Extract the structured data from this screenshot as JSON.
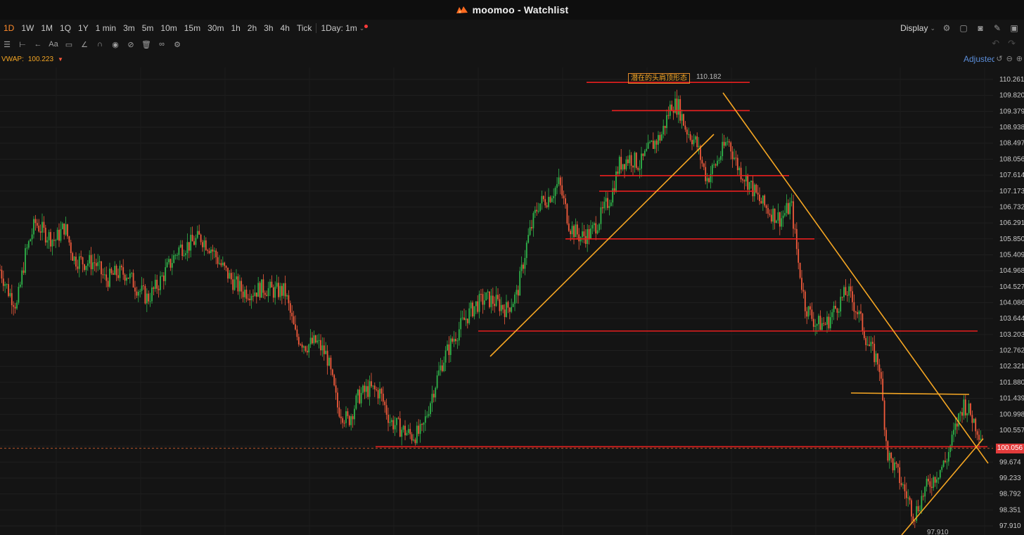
{
  "window": {
    "app_name": "moomoo",
    "title": "moomoo - Watchlist"
  },
  "toolbar": {
    "intervals": [
      {
        "label": "1D",
        "active": true
      },
      {
        "label": "1W"
      },
      {
        "label": "1M"
      },
      {
        "label": "1Q"
      },
      {
        "label": "1Y"
      },
      {
        "label": "1 min"
      },
      {
        "label": "3m"
      },
      {
        "label": "5m"
      },
      {
        "label": "10m"
      },
      {
        "label": "15m"
      },
      {
        "label": "30m"
      },
      {
        "label": "1h"
      },
      {
        "label": "2h"
      },
      {
        "label": "3h"
      },
      {
        "label": "4h"
      },
      {
        "label": "Tick"
      }
    ],
    "day_selector": "1Day: 1m",
    "display_label": "Display"
  },
  "indicators": {
    "vwap_label": "VWAP:",
    "vwap_value": "100.223"
  },
  "adjust_label": "Adjusted",
  "chart": {
    "price_axis": [
      "110.261",
      "109.820",
      "109.379",
      "108.938",
      "108.497",
      "108.056",
      "107.614",
      "107.173",
      "106.732",
      "106.291",
      "105.850",
      "105.409",
      "104.968",
      "104.527",
      "104.086",
      "103.644",
      "103.203",
      "102.762",
      "102.321",
      "101.880",
      "101.439",
      "100.998",
      "100.557",
      "100.056",
      "99.674",
      "99.233",
      "98.792",
      "98.351",
      "97.910"
    ],
    "current_price": "100.056",
    "high_label": "110.182",
    "low_label": "97.910",
    "annotation_text": "潜在的头肩顶形态",
    "colors": {
      "up": "#2fb34a",
      "down": "#f05a3b",
      "support": "#e81e1e",
      "trend": "#f5a623",
      "background": "#141414"
    }
  },
  "chart_data": {
    "type": "candlestick",
    "title": "",
    "ylim": [
      97.91,
      110.261
    ],
    "price_path": [
      [
        0,
        105.0
      ],
      [
        12,
        104.4
      ],
      [
        24,
        104.0
      ],
      [
        36,
        105.4
      ],
      [
        50,
        106.3
      ],
      [
        64,
        106.0
      ],
      [
        78,
        105.8
      ],
      [
        92,
        106.2
      ],
      [
        105,
        105.3
      ],
      [
        120,
        105.2
      ],
      [
        135,
        105.2
      ],
      [
        150,
        104.7
      ],
      [
        165,
        104.9
      ],
      [
        180,
        104.9
      ],
      [
        195,
        104.5
      ],
      [
        210,
        104.2
      ],
      [
        225,
        104.6
      ],
      [
        240,
        105.1
      ],
      [
        255,
        105.6
      ],
      [
        270,
        105.7
      ],
      [
        285,
        105.9
      ],
      [
        300,
        105.6
      ],
      [
        315,
        105.1
      ],
      [
        330,
        104.7
      ],
      [
        345,
        104.4
      ],
      [
        360,
        104.4
      ],
      [
        375,
        104.5
      ],
      [
        390,
        104.4
      ],
      [
        405,
        104.4
      ],
      [
        420,
        103.2
      ],
      [
        435,
        102.9
      ],
      [
        450,
        103.0
      ],
      [
        465,
        102.6
      ],
      [
        480,
        101.2
      ],
      [
        495,
        100.8
      ],
      [
        510,
        101.5
      ],
      [
        525,
        101.7
      ],
      [
        540,
        101.6
      ],
      [
        555,
        100.8
      ],
      [
        570,
        100.6
      ],
      [
        585,
        100.4
      ],
      [
        600,
        100.5
      ],
      [
        615,
        101.6
      ],
      [
        630,
        102.5
      ],
      [
        645,
        103.1
      ],
      [
        660,
        103.6
      ],
      [
        675,
        104.0
      ],
      [
        690,
        104.2
      ],
      [
        705,
        104.1
      ],
      [
        720,
        103.9
      ],
      [
        735,
        104.3
      ],
      [
        750,
        105.8
      ],
      [
        765,
        106.8
      ],
      [
        780,
        107.0
      ],
      [
        795,
        107.4
      ],
      [
        810,
        106.2
      ],
      [
        825,
        105.9
      ],
      [
        840,
        106.0
      ],
      [
        855,
        106.5
      ],
      [
        870,
        107.1
      ],
      [
        880,
        107.9
      ],
      [
        895,
        108.1
      ],
      [
        910,
        107.9
      ],
      [
        925,
        108.4
      ],
      [
        940,
        108.7
      ],
      [
        955,
        109.6
      ],
      [
        965,
        109.5
      ],
      [
        975,
        108.9
      ],
      [
        990,
        108.5
      ],
      [
        1005,
        107.5
      ],
      [
        1020,
        108.0
      ],
      [
        1035,
        108.6
      ],
      [
        1050,
        107.8
      ],
      [
        1065,
        107.4
      ],
      [
        1080,
        106.9
      ],
      [
        1095,
        106.6
      ],
      [
        1110,
        106.4
      ],
      [
        1125,
        106.8
      ],
      [
        1135,
        105.2
      ],
      [
        1145,
        104.0
      ],
      [
        1160,
        103.5
      ],
      [
        1175,
        103.5
      ],
      [
        1190,
        104.0
      ],
      [
        1205,
        104.4
      ],
      [
        1220,
        103.8
      ],
      [
        1235,
        102.9
      ],
      [
        1250,
        102.4
      ],
      [
        1262,
        99.9
      ],
      [
        1275,
        99.4
      ],
      [
        1290,
        98.7
      ],
      [
        1300,
        98.2
      ],
      [
        1315,
        98.9
      ],
      [
        1330,
        99.3
      ],
      [
        1345,
        99.7
      ],
      [
        1360,
        100.7
      ],
      [
        1370,
        101.3
      ],
      [
        1380,
        101.0
      ],
      [
        1395,
        100.4
      ]
    ],
    "support_lines": [
      110.18,
      109.4,
      107.6,
      107.17,
      105.85,
      103.3,
      100.1
    ],
    "neckline_note": "潜在的头肩顶形态"
  }
}
